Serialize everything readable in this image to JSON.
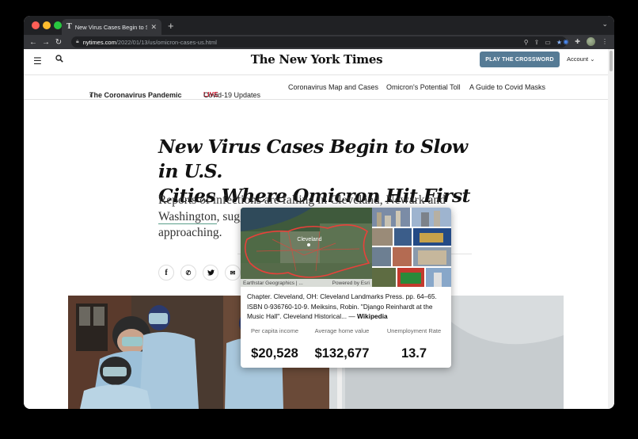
{
  "browser": {
    "tab_title": "New Virus Cases Begin to Slow",
    "tab_favicon": "T",
    "url_host": "nytimes.com",
    "url_path": "/2022/01/13/us/omicron-cases-us.html"
  },
  "masthead": {
    "logo": "The New York Times",
    "crossword_label": "PLAY THE CROSSWORD",
    "account_label": "Account"
  },
  "subnav": {
    "section": "The Coronavirus Pandemic",
    "section_chevron": "›",
    "live_badge": "LIVE",
    "items": [
      "Covid-19 Updates",
      "Coronavirus Map and Cases",
      "Omicron's Potential Toll",
      "A Guide to Covid Masks"
    ]
  },
  "article": {
    "headline_line1": "New Virus Cases Begin to Slow in U.S.",
    "headline_line2": "Cities Where Omicron Hit First",
    "summary_line1": "Reports of infections are falling in Cleveland, Newark and",
    "summary_line2_u": "Washington",
    "summary_line2_rest": ", sugg",
    "summary_line3": "approaching."
  },
  "share": {
    "icons": [
      "facebook-icon",
      "whatsapp-icon",
      "twitter-icon",
      "email-icon"
    ]
  },
  "popup": {
    "map_label": "Cleveland",
    "attribution_left": "Earthstar Geographics | ...",
    "attribution_right": "Powered by Esri",
    "extract": "Chapter. Cleveland, OH: Cleveland Landmarks Press. pp. 64–65. ISBN 0-936760-10-9. Meiksins, Robin. \"Django Reinhardt at the Music Hall\". Cleveland Historical... — ",
    "extract_source": "Wikipedia",
    "stats": [
      {
        "label": "Per capita income",
        "value": "$20,528"
      },
      {
        "label": "Average home value",
        "value": "$132,677"
      },
      {
        "label": "Unemployment Rate",
        "value": "13.7"
      }
    ]
  },
  "colors": {
    "crossword_button": "#567b95",
    "live_red": "#d0021b",
    "map_outline": "#e8413a"
  }
}
